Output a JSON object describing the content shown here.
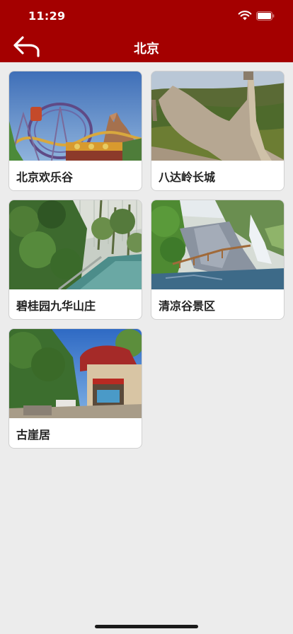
{
  "status_bar": {
    "time": "11:29"
  },
  "nav": {
    "title": "北京",
    "back_icon": "back-arrow-icon"
  },
  "colors": {
    "header": "#a40000",
    "background": "#ececec",
    "card": "#ffffff"
  },
  "places": [
    {
      "name": "北京欢乐谷",
      "image": "amusement-park-rollercoaster"
    },
    {
      "name": "八达岭长城",
      "image": "great-wall"
    },
    {
      "name": "碧桂园九华山庄",
      "image": "greenhouse-garden"
    },
    {
      "name": "清凉谷景区",
      "image": "waterfall-valley"
    },
    {
      "name": "古崖居",
      "image": "cliff-dwelling-gate"
    }
  ]
}
